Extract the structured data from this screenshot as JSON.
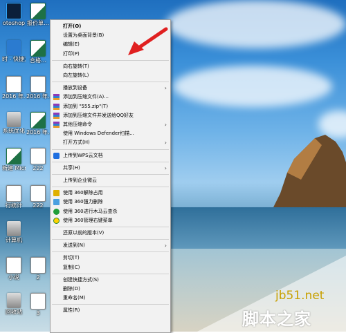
{
  "desktop": {
    "icons": [
      {
        "label": "otoshop",
        "type": "ps"
      },
      {
        "label": "报价单…",
        "type": "xl"
      },
      {
        "label": "时 - 快捷方式",
        "type": "blue"
      },
      {
        "label": "合格…",
        "type": "xl"
      },
      {
        "label": "2016 年…",
        "type": "doc"
      },
      {
        "label": "2016 年…",
        "type": "doc"
      },
      {
        "label": "系统优化",
        "type": "sys"
      },
      {
        "label": "2016 年…",
        "type": "xl"
      },
      {
        "label": "新建 Microsoft…",
        "type": "xl"
      },
      {
        "label": "222",
        "type": "doc"
      },
      {
        "label": "行统计",
        "type": "doc"
      },
      {
        "label": "222",
        "type": "doc"
      },
      {
        "label": "计算机",
        "type": "sys"
      },
      {
        "label": "小说",
        "type": "doc"
      },
      {
        "label": "2",
        "type": "doc"
      },
      {
        "label": "回收站",
        "type": "sys"
      },
      {
        "label": "3",
        "type": "doc"
      }
    ]
  },
  "context_menu": {
    "items": [
      {
        "label": "打开(O)",
        "bold": true,
        "icon": "",
        "submenu": false
      },
      {
        "label": "设置为桌面背景(B)",
        "icon": "",
        "submenu": false
      },
      {
        "label": "编辑(E)",
        "icon": "",
        "submenu": false
      },
      {
        "label": "打印(P)",
        "icon": "",
        "submenu": false
      },
      {
        "sep": true
      },
      {
        "label": "向右旋转(T)",
        "icon": "",
        "submenu": false
      },
      {
        "label": "向左旋转(L)",
        "icon": "",
        "submenu": false
      },
      {
        "sep": true
      },
      {
        "label": "播放到设备",
        "icon": "",
        "submenu": true
      },
      {
        "label": "添加到压缩文件(A)...",
        "icon": "rar",
        "submenu": false
      },
      {
        "label": "添加到 \"555.zip\"(T)",
        "icon": "rar",
        "submenu": false
      },
      {
        "label": "添加到压缩文件并发送给QQ好友",
        "icon": "rar",
        "submenu": false
      },
      {
        "label": "其他压缩命令",
        "icon": "rar",
        "submenu": true
      },
      {
        "label": "使用 Windows Defender扫描...",
        "icon": "",
        "submenu": false
      },
      {
        "label": "打开方式(H)",
        "icon": "",
        "submenu": true
      },
      {
        "sep": true
      },
      {
        "label": "上传到WPS云文档",
        "icon": "wps",
        "submenu": false
      },
      {
        "sep": true
      },
      {
        "label": "共享(H)",
        "icon": "",
        "submenu": true
      },
      {
        "sep": true
      },
      {
        "label": "上传到企业微云",
        "icon": "",
        "submenu": false
      },
      {
        "sep": true
      },
      {
        "label": "使用 360解除占用",
        "icon": "unlock",
        "submenu": false
      },
      {
        "label": "使用 360强力删除",
        "icon": "del",
        "submenu": false
      },
      {
        "label": "使用 360进行木马云查杀",
        "icon": "trojan",
        "submenu": false
      },
      {
        "label": "使用 360管理右键菜单",
        "icon": "yel",
        "submenu": false
      },
      {
        "sep": true
      },
      {
        "label": "还原以前的版本(V)",
        "icon": "",
        "submenu": false
      },
      {
        "sep": true
      },
      {
        "label": "发送到(N)",
        "icon": "",
        "submenu": true
      },
      {
        "sep": true
      },
      {
        "label": "剪切(T)",
        "icon": "",
        "submenu": false
      },
      {
        "label": "复制(C)",
        "icon": "",
        "submenu": false
      },
      {
        "sep": true
      },
      {
        "label": "创建快捷方式(S)",
        "icon": "",
        "submenu": false
      },
      {
        "label": "删除(D)",
        "icon": "",
        "submenu": false
      },
      {
        "label": "重命名(M)",
        "icon": "",
        "submenu": false
      },
      {
        "sep": true
      },
      {
        "label": "属性(R)",
        "icon": "",
        "submenu": false
      }
    ]
  },
  "watermark": {
    "site": "jb51.net",
    "name": "脚本之家"
  },
  "colors": {
    "menu_bg": "#f2f2f2",
    "arrow": "#e02020",
    "watermark_gold": "#c8a000"
  }
}
